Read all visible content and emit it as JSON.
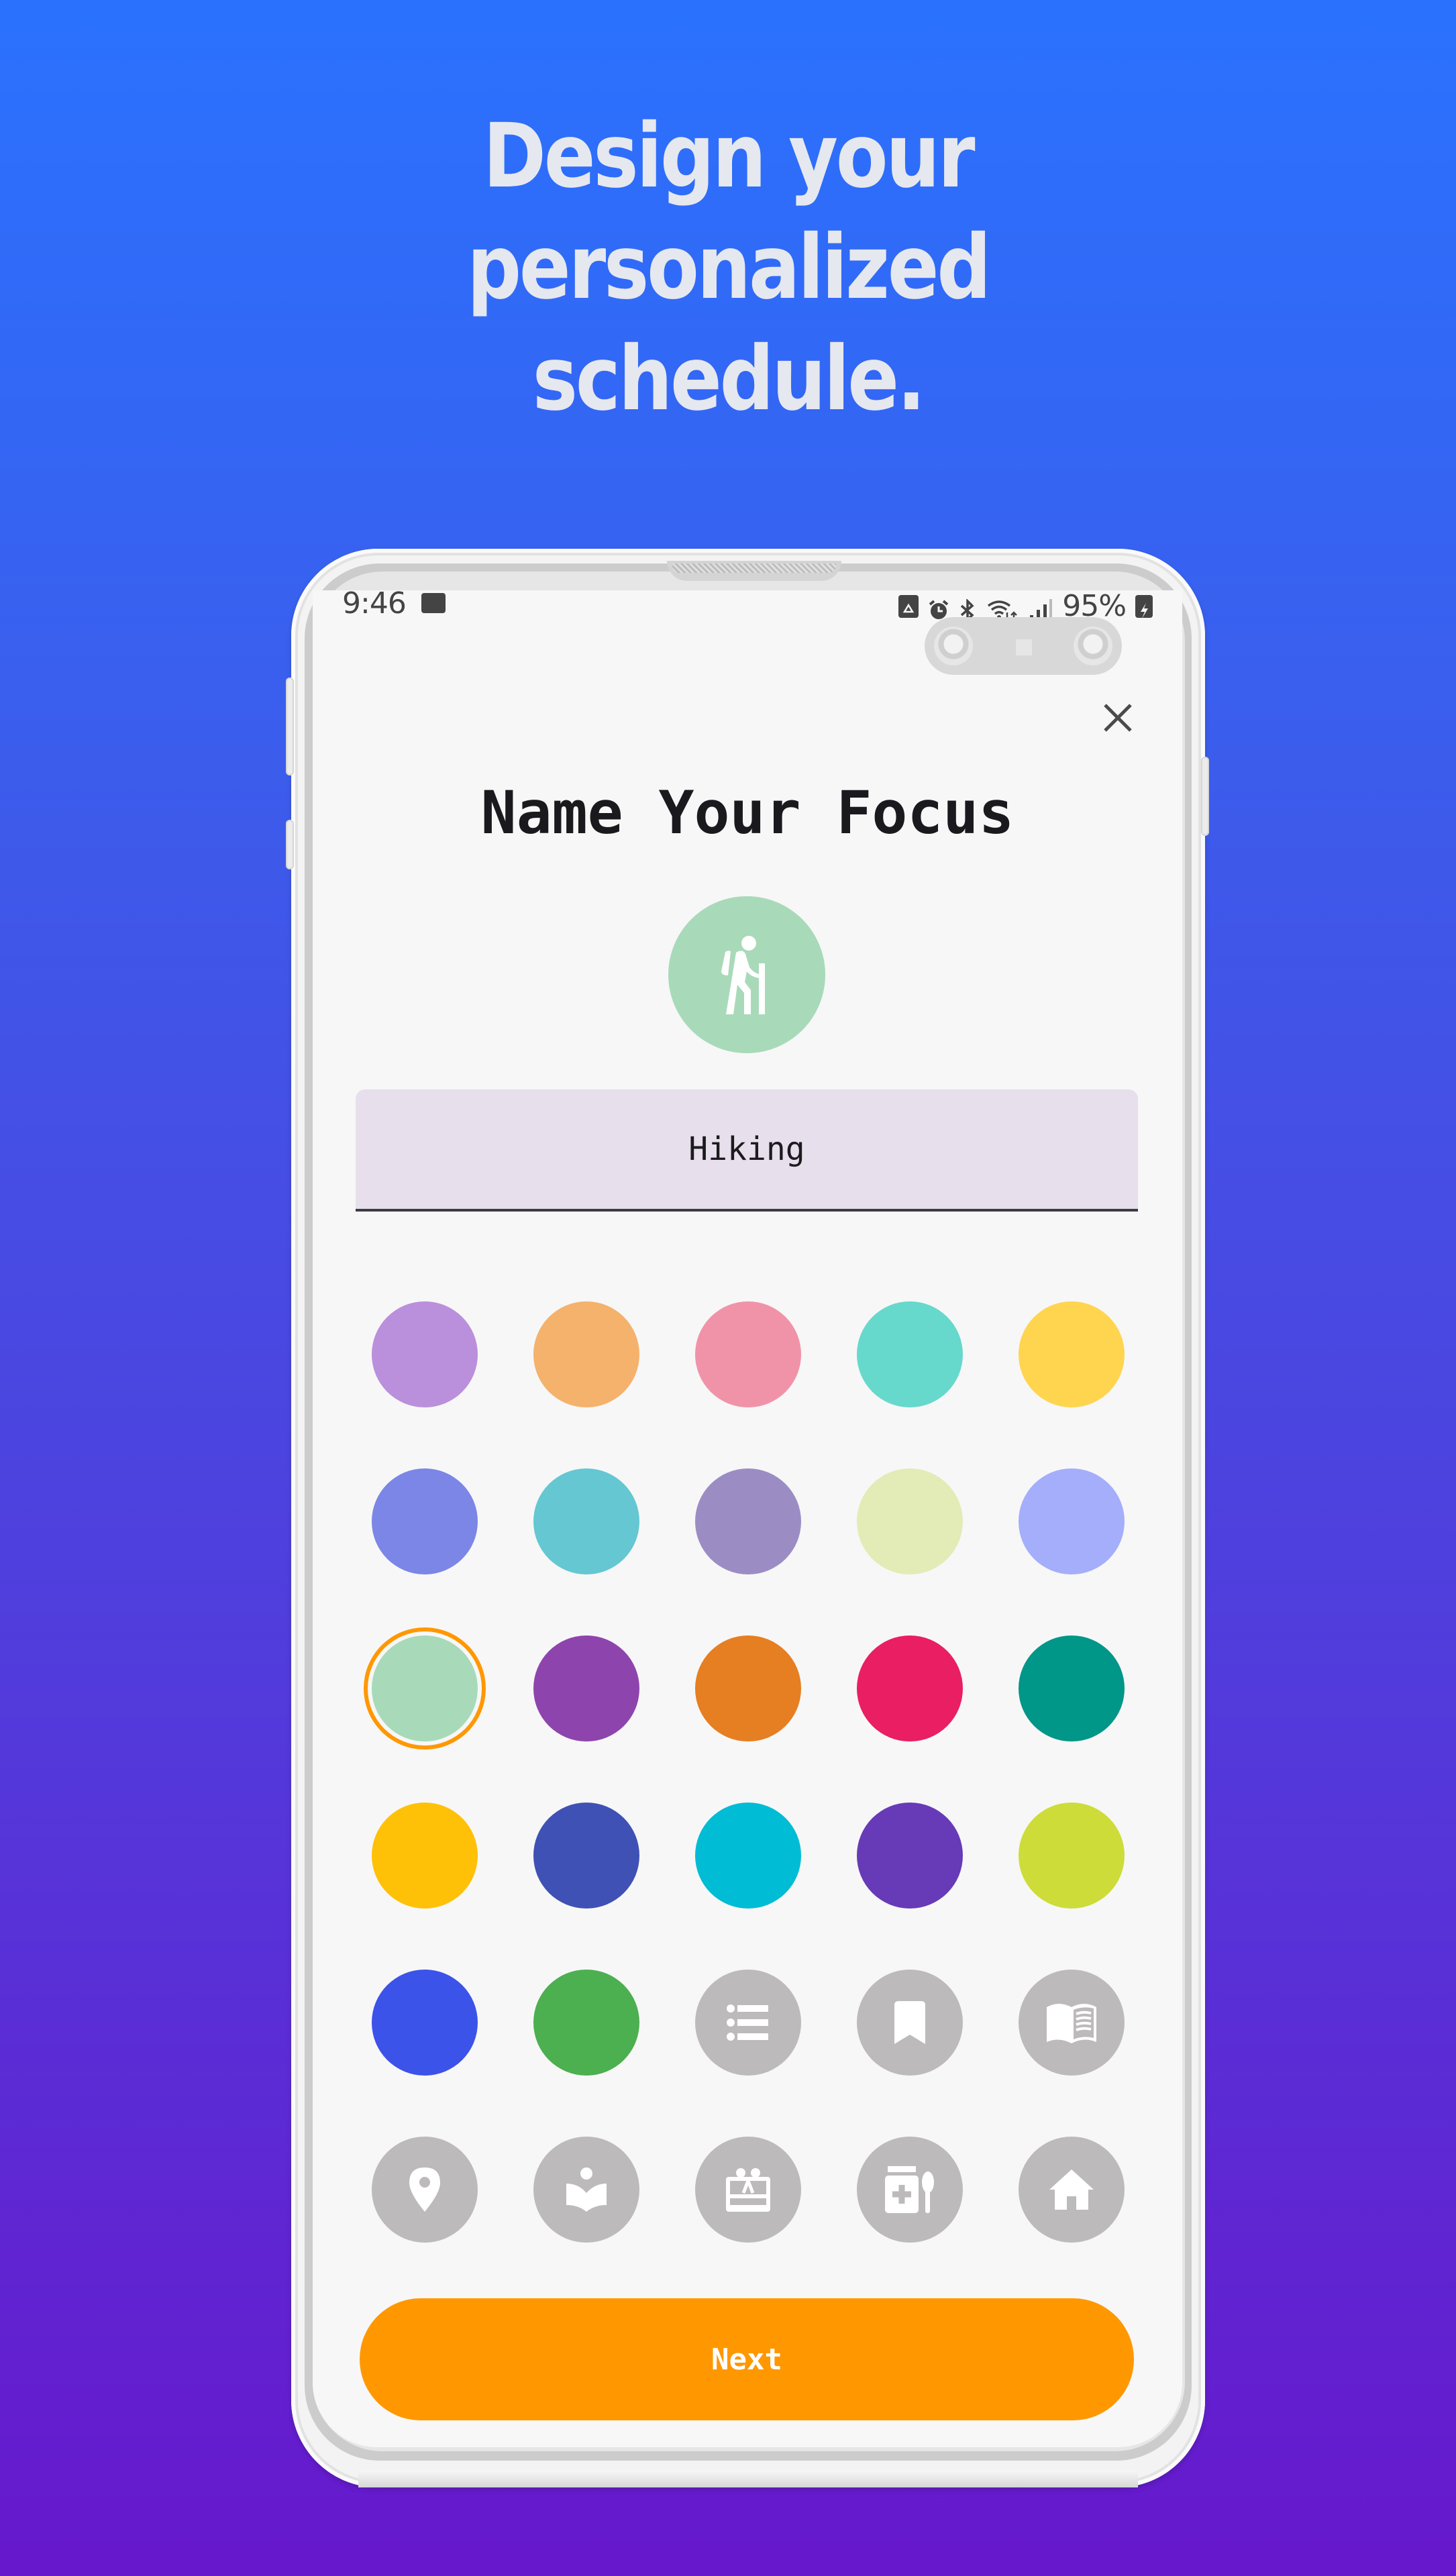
{
  "promo": {
    "headline_lines": [
      "Design your",
      "personalized",
      "schedule."
    ]
  },
  "status_bar": {
    "time": "9:46",
    "left_icons": [
      "calendar-notification-icon"
    ],
    "right_icons": [
      "recycle-notification-icon",
      "alarm-icon",
      "bluetooth-icon",
      "wifi-data-icon",
      "signal-icon"
    ],
    "battery_percent": "95%",
    "battery_state": "charging"
  },
  "dialog": {
    "title": "Name Your Focus",
    "close_icon": "close-icon",
    "selected_icon": "hiking-icon",
    "selected_color": "#a8dab9",
    "name_field": {
      "value": "Hiking",
      "placeholder": ""
    },
    "color_swatches": [
      "#ba8fdc",
      "#f4b26c",
      "#f093a8",
      "#67d8cc",
      "#ffd54f",
      "#7b86e6",
      "#64c7d2",
      "#9b8dc4",
      "#e3ebb6",
      "#a4aefa",
      "#a8dab9",
      "#8e44ad",
      "#e67e22",
      "#e91e63",
      "#009688",
      "#ffc107",
      "#3f51b5",
      "#00bcd4",
      "#673ab7",
      "#cddc39",
      "#3b53e9",
      "#4caf50"
    ],
    "selected_swatch_index": 10,
    "icon_options": [
      "list-icon",
      "bookmark-icon",
      "open-book-icon",
      "location-pin-icon",
      "reading-person-icon",
      "gift-card-icon",
      "medicine-spoon-icon",
      "home-icon"
    ],
    "icon_option_bg": "#bcbabb",
    "selection_ring_color": "#ff9800",
    "next_button_label": "Next",
    "next_button_color": "#ff9800"
  }
}
